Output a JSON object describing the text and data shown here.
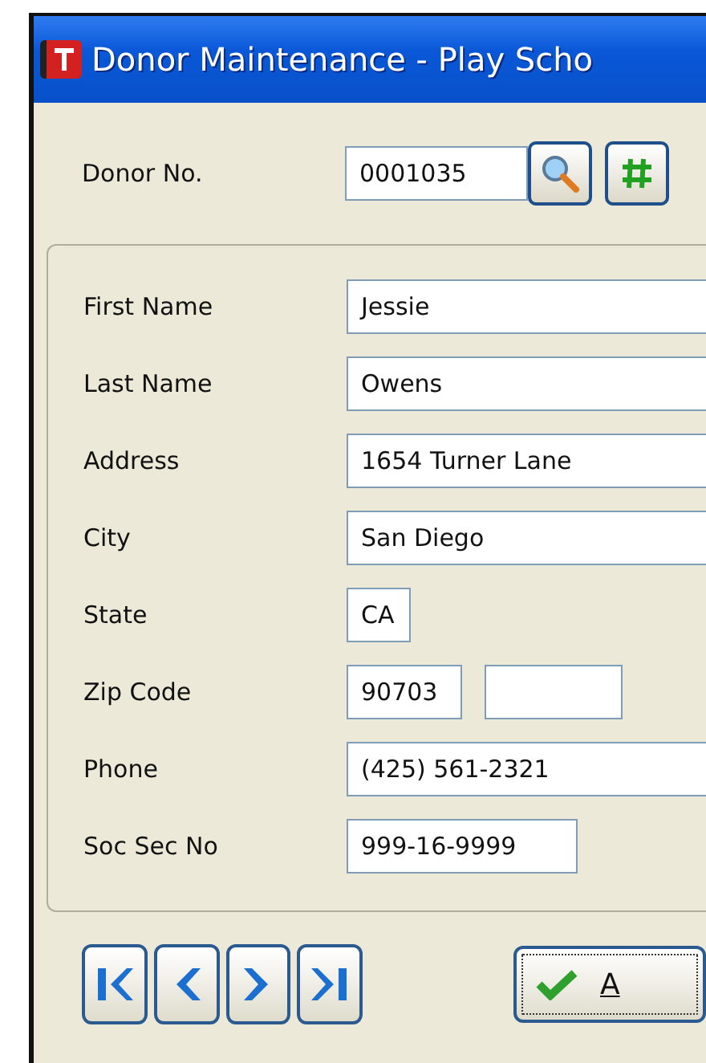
{
  "window": {
    "title": "Donor Maintenance - Play Scho"
  },
  "donor": {
    "label": "Donor No.",
    "value": "0001035"
  },
  "fields": [
    {
      "label": "First Name",
      "value": "Jessie"
    },
    {
      "label": "Last Name",
      "value": "Owens"
    },
    {
      "label": "Address",
      "value": "1654 Turner Lane"
    },
    {
      "label": "City",
      "value": "San Diego"
    },
    {
      "label": "State",
      "value": "CA"
    },
    {
      "label": "Zip Code",
      "value": "90703",
      "extra_field": true
    },
    {
      "label": "Phone",
      "value": "(425) 561-2321"
    },
    {
      "label": "Soc Sec No",
      "value": "999-16-9999"
    }
  ],
  "nav_buttons": [
    {
      "kind": "first"
    },
    {
      "kind": "prev"
    },
    {
      "kind": "next"
    },
    {
      "kind": "last"
    }
  ],
  "ok_button": {
    "label": "A"
  }
}
